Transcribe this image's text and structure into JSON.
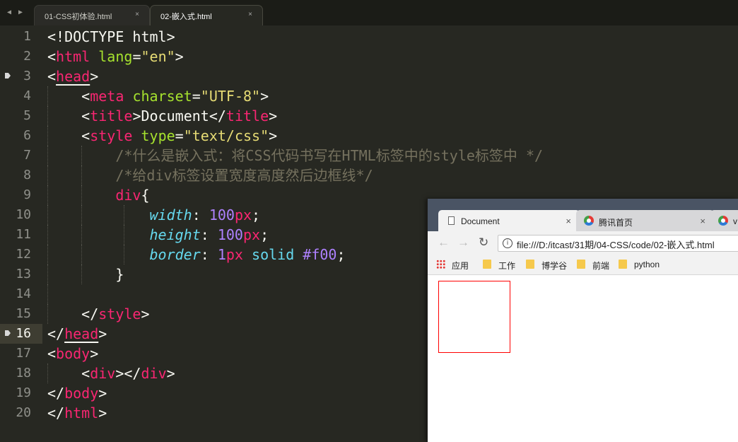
{
  "editor": {
    "nav_arrows": "◀ ▶",
    "tabs": [
      {
        "label": "01-CSS初体验.html",
        "close": "×"
      },
      {
        "label": "02-嵌入式.html",
        "close": "×"
      }
    ],
    "line_numbers": [
      "1",
      "2",
      "3",
      "4",
      "5",
      "6",
      "7",
      "8",
      "9",
      "10",
      "11",
      "12",
      "13",
      "14",
      "15",
      "16",
      "17",
      "18",
      "19",
      "20"
    ],
    "code": {
      "doctype": "<!DOCTYPE html>",
      "lt": "<",
      "gt": ">",
      "lt_slash": "</",
      "eq": "=",
      "html": "html",
      "lang": "lang",
      "lang_val": "\"en\"",
      "head": "head",
      "meta": "meta",
      "charset": "charset",
      "charset_val": "\"UTF-8\"",
      "title": "title",
      "title_text": "Document",
      "style": "style",
      "type": "type",
      "type_val": "\"text/css\"",
      "comment1": "/*什么是嵌入式：将CSS代码书写在HTML标签中的style标签中 */",
      "comment2": "/*给div标签设置宽度高度然后边框线*/",
      "selector": "div",
      "brace_open": "{",
      "brace_close": "}",
      "width_prop": "width",
      "width_val": "100",
      "height_prop": "height",
      "height_val": "100",
      "unit_px": "px",
      "colon": ":",
      "semi": ";",
      "border_prop": "border",
      "border_num": "1",
      "border_style": "solid",
      "border_color": "#f00",
      "body": "body",
      "div": "div"
    }
  },
  "browser": {
    "tabs": [
      {
        "label": "Document",
        "close": "×"
      },
      {
        "label": "腾讯首页",
        "close": "×"
      },
      {
        "label": "v"
      }
    ],
    "nav": {
      "back": "←",
      "forward": "→",
      "reload": "↻",
      "info": "i"
    },
    "url": "file:///D:/itcast/31期/04-CSS/code/02-嵌入式.html",
    "bookmarks": [
      "应用",
      "工作",
      "博学谷",
      "前端",
      "python"
    ],
    "demo_border_color": "#ff0000"
  }
}
